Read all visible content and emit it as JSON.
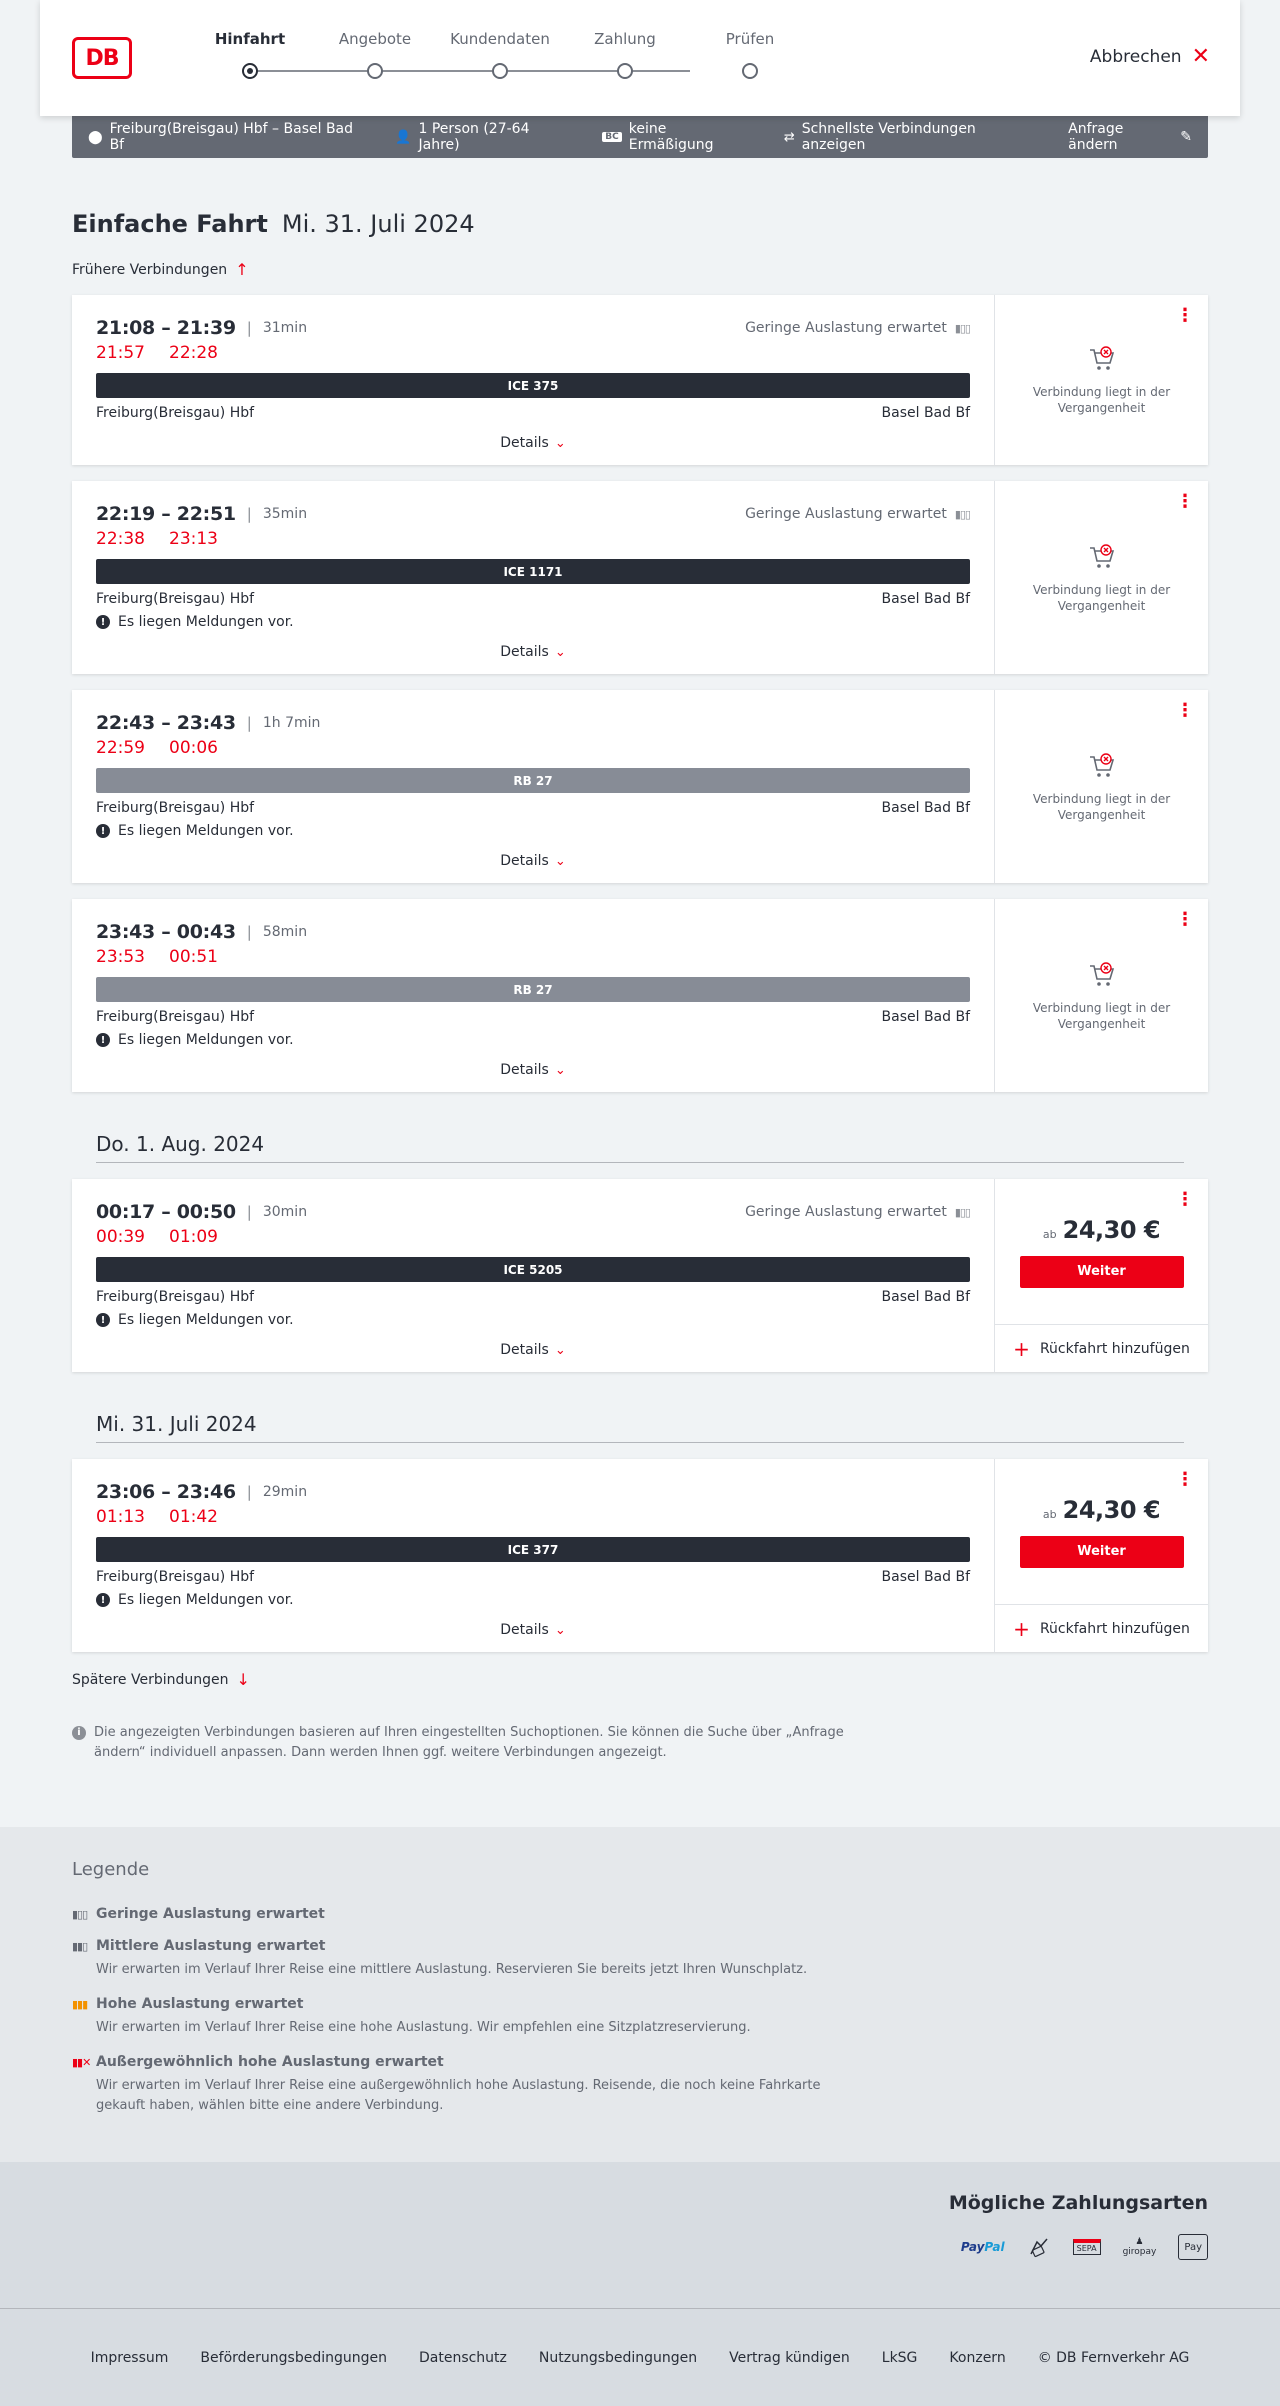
{
  "header": {
    "logo": "DB",
    "steps": [
      {
        "label": "Hinfahrt",
        "active": true
      },
      {
        "label": "Angebote",
        "active": false
      },
      {
        "label": "Kundendaten",
        "active": false
      },
      {
        "label": "Zahlung",
        "active": false
      },
      {
        "label": "Prüfen",
        "active": false
      }
    ],
    "cancel_label": "Abbrechen"
  },
  "query": {
    "route": "Freiburg(Breisgau) Hbf – Basel Bad Bf",
    "travelers": "1 Person (27-64 Jahre)",
    "discount_badge": "BC",
    "discount": "keine Ermäßigung",
    "mode": "Schnellste Verbindungen anzeigen",
    "change_label": "Anfrage ändern"
  },
  "title": {
    "type": "Einfache Fahrt",
    "date": "Mi. 31. Juli 2024"
  },
  "earlier_label": "Frühere Verbindungen",
  "later_label": "Spätere Verbindungen",
  "common": {
    "details_label": "Details",
    "message_text": "Es liegen Meldungen vor.",
    "past_text": "Verbindung liegt in der Vergangenheit",
    "price_prefix": "ab",
    "weiter_label": "Weiter",
    "return_label": "Rückfahrt hinzufügen",
    "load_text": "Geringe Auslastung erwartet"
  },
  "connections_day1": [
    {
      "times": "21:08 – 21:39",
      "duration": "31min",
      "rt_dep": "21:57",
      "rt_arr": "22:28",
      "train": "ICE 375",
      "regional": false,
      "from": "Freiburg(Breisgau) Hbf",
      "to": "Basel Bad Bf",
      "load": true,
      "message": false
    },
    {
      "times": "22:19 – 22:51",
      "duration": "35min",
      "rt_dep": "22:38",
      "rt_arr": "23:13",
      "train": "ICE 1171",
      "regional": false,
      "from": "Freiburg(Breisgau) Hbf",
      "to": "Basel Bad Bf",
      "load": true,
      "message": true
    },
    {
      "times": "22:43 – 23:43",
      "duration": "1h 7min",
      "rt_dep": "22:59",
      "rt_arr": "00:06",
      "train": "RB 27",
      "regional": true,
      "from": "Freiburg(Breisgau) Hbf",
      "to": "Basel Bad Bf",
      "load": false,
      "message": true
    },
    {
      "times": "23:43 – 00:43",
      "duration": "58min",
      "rt_dep": "23:53",
      "rt_arr": "00:51",
      "train": "RB 27",
      "regional": true,
      "from": "Freiburg(Breisgau) Hbf",
      "to": "Basel Bad Bf",
      "load": false,
      "message": true
    }
  ],
  "date_sep_1": "Do. 1. Aug. 2024",
  "connection_day2": {
    "times": "00:17 – 00:50",
    "duration": "30min",
    "rt_dep": "00:39",
    "rt_arr": "01:09",
    "train": "ICE 5205",
    "from": "Freiburg(Breisgau) Hbf",
    "to": "Basel Bad Bf",
    "price": "24,30 €"
  },
  "date_sep_2": "Mi. 31. Juli 2024",
  "connection_day3": {
    "times": "23:06 – 23:46",
    "duration": "29min",
    "rt_dep": "01:13",
    "rt_arr": "01:42",
    "train": "ICE 377",
    "from": "Freiburg(Breisgau) Hbf",
    "to": "Basel Bad Bf",
    "price": "24,30 €"
  },
  "info_note": "Die angezeigten Verbindungen basieren auf Ihren eingestellten Suchoptionen. Sie können die Suche über „Anfrage ändern“ individuell anpassen. Dann werden Ihnen ggf. weitere Verbindungen angezeigt.",
  "legend": {
    "title": "Legende",
    "items": [
      {
        "title": "Geringe Auslastung erwartet",
        "desc": "",
        "color": "#646973"
      },
      {
        "title": "Mittlere Auslastung erwartet",
        "desc": "Wir erwarten im Verlauf Ihrer Reise eine mittlere Auslastung. Reservieren Sie bereits jetzt Ihren Wunschplatz.",
        "color": "#646973"
      },
      {
        "title": "Hohe Auslastung erwartet",
        "desc": "Wir erwarten im Verlauf Ihrer Reise eine hohe Auslastung. Wir empfehlen eine Sitzplatzreservierung.",
        "color": "#f39200"
      },
      {
        "title": "Außergewöhnlich hohe Auslastung erwartet",
        "desc": "Wir erwarten im Verlauf Ihrer Reise eine außergewöhnlich hohe Auslastung. Reisende, die noch keine Fahrkarte gekauft haben, wählen bitte eine andere Verbindung.",
        "color": "#ec0016"
      }
    ]
  },
  "payment": {
    "title": "Mögliche Zahlungsarten",
    "paypal_a": "Pay",
    "paypal_b": "Pal",
    "sepa": "SEPA",
    "giropay": "giropay",
    "applepay": "Pay"
  },
  "footer": [
    "Impressum",
    "Beförderungsbedingungen",
    "Datenschutz",
    "Nutzungsbedingungen",
    "Vertrag kündigen",
    "LkSG",
    "Konzern",
    "© DB Fernverkehr AG"
  ]
}
